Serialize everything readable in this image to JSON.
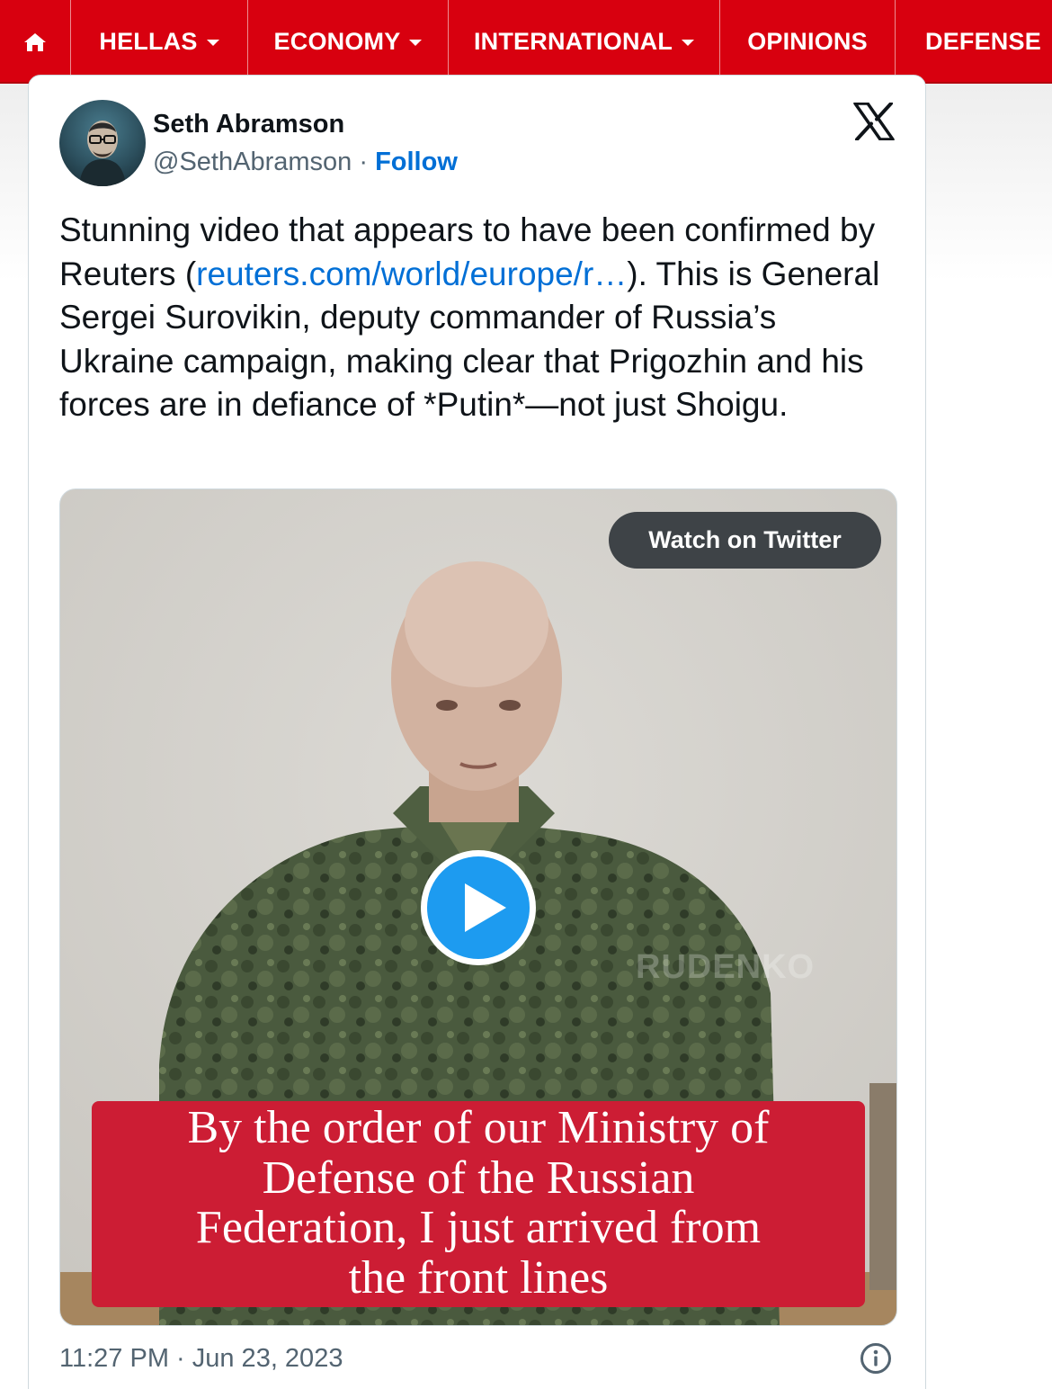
{
  "nav": {
    "items": [
      {
        "label": "HELLAS",
        "has_dropdown": true
      },
      {
        "label": "ECONOMY",
        "has_dropdown": true
      },
      {
        "label": "INTERNATIONAL",
        "has_dropdown": true
      },
      {
        "label": "OPINIONS",
        "has_dropdown": false
      },
      {
        "label": "DEFENSE",
        "has_dropdown": false
      }
    ],
    "home_icon": "home-icon",
    "bg_color": "#d8000f"
  },
  "tweet": {
    "author_name": "Seth Abramson",
    "handle": "@SethAbramson",
    "separator": " · ",
    "follow_label": "Follow",
    "platform_icon": "x-logo-icon",
    "text_before_link": "Stunning video that appears to have been confirmed by Reuters (",
    "link_text": "reuters.com/world/europe/r…",
    "text_after_link": "). This is General Sergei Surovikin, deputy commander of Russia’s Ukraine campaign, making clear that Prigozhin and his forces are in defiance of *Putin*—not just Shoigu.",
    "link_color": "#006fd6",
    "media": {
      "watch_label": "Watch on Twitter",
      "play_icon": "play-icon",
      "watermark": "RUDENKO",
      "caption_lines": [
        "By the order of our Ministry of",
        "Defense of the Russian",
        "Federation, I just arrived from",
        "the front lines"
      ],
      "caption_bg": "#cc1d34"
    },
    "timestamp": "11:27 PM · Jun 23, 2023",
    "info_icon": "info-icon"
  }
}
